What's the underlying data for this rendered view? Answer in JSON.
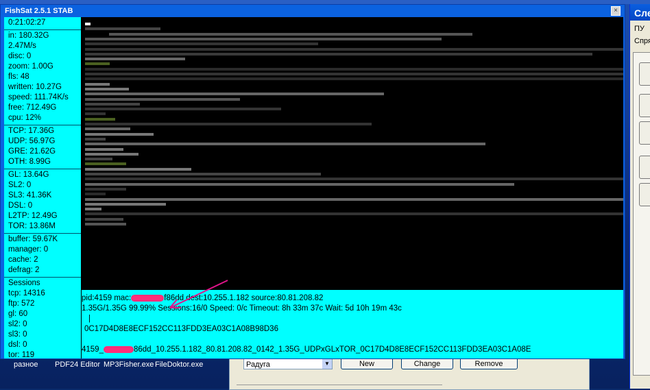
{
  "desktop": {
    "taskbar_labels": [
      "разное",
      "PDF24 Editor",
      "MP3Fisher.exe",
      "FileDoktor.exe"
    ]
  },
  "right_window": {
    "title": "Сле",
    "label_1": "ПУ",
    "label_2": "Спря"
  },
  "window": {
    "title": "FishSat 2.5.1 STAB",
    "close_glyph": "×"
  },
  "sidebar": {
    "time": "0:21:02:27",
    "stats": [
      "in: 180.32G",
      "2.47M/s",
      "disc: 0",
      "zoom: 1.00G",
      "fls: 48",
      "written: 10.27G",
      "speed: 111.74K/s",
      "free: 712.49G",
      "cpu: 12%"
    ],
    "protocols": [
      "TCP: 17.36G",
      "UDP: 56.97G",
      "GRE: 21.62G",
      "OTH: 8.99G"
    ],
    "layers": [
      "GL: 13.64G",
      "SL2: 0",
      "SL3: 41.36K",
      "DSL: 0",
      "L2TP: 12.49G",
      "TOR: 13.86M"
    ],
    "buffers": [
      "buffer: 59.67K",
      "manager: 0",
      "cache: 2",
      "defrag: 2"
    ],
    "sessions": [
      "Sessions",
      "tcp: 14316",
      "ftp: 572",
      "gl: 60",
      "sl2: 0",
      "sl3: 0",
      "dsl: 0",
      "tor: 119"
    ]
  },
  "info": {
    "line1_a": "pid:4159  mac:",
    "line1_b": "f86dd  dest:10.255.1.182  source:80.81.208.82",
    "line2": "1.35G/1.35G   99.99%   Sessions:16/0  Speed: 0/c  Timeout:  8h 33m 37c  Wait:  5d 10h 19m 43c",
    "line3": "|",
    "line4": "0C17D4D8E8ECF152CC113FDD3EA03C1A08B98D36",
    "line5_a": "4159_",
    "line5_b": "86dd_10.255.1.182_80.81.208.82_0142_1.35G_UDPxGLxTOR_0C17D4D8E8ECF152CC113FDD3EA03C1A08E"
  },
  "dialog": {
    "combo_value": "Радуга",
    "new_label": "New",
    "change_label": "Change",
    "remove_label": "Remove"
  },
  "colors": {
    "panel": "#00ffff",
    "viz_bg": "#000000",
    "redaction": "#ff2e7a",
    "arrow": "#e0148a"
  }
}
